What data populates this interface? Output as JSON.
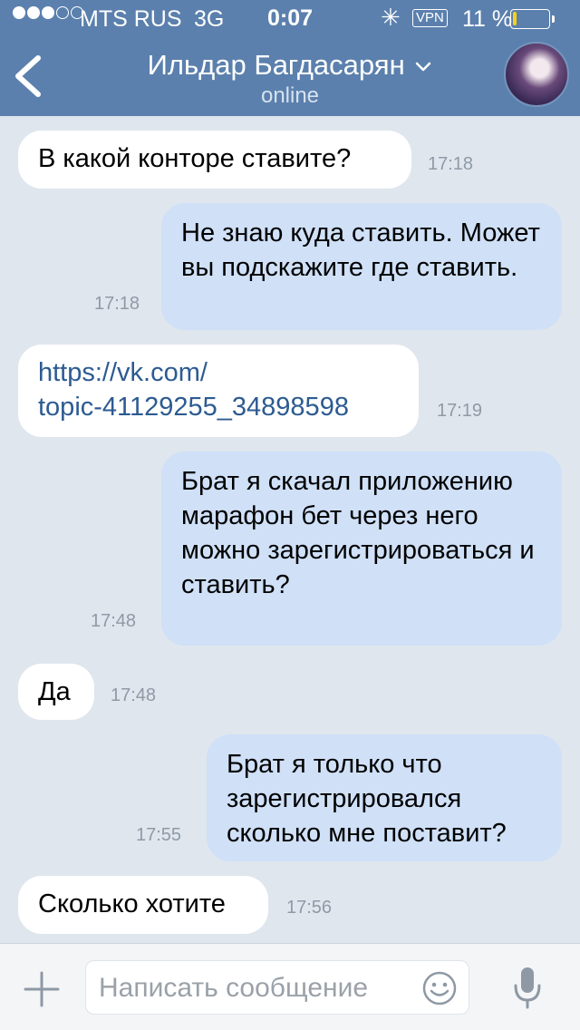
{
  "status_bar": {
    "carrier": "MTS RUS",
    "network": "3G",
    "time": "0:07",
    "vpn": "VPN",
    "battery_percent": "11 %",
    "battery_level": 0.11,
    "battery_color": "#f7d11a"
  },
  "header": {
    "contact_name": "Ильдар Багдасарян",
    "contact_status": "online",
    "back_icon": "chevron-left-icon",
    "name_dropdown_icon": "chevron-down-icon",
    "background": "#5b80ad"
  },
  "messages": [
    {
      "direction": "incoming",
      "text": "В какой конторе ставите?",
      "time": "17:18"
    },
    {
      "direction": "outgoing",
      "text": "Не знаю куда ставить. Может вы подскажите где ставить.",
      "time": "17:18"
    },
    {
      "direction": "incoming",
      "text": "https://vk.com/topic-41129255_34898598",
      "time": "17:19",
      "is_link": true
    },
    {
      "direction": "outgoing",
      "text": "Брат я скачал приложению марафон бет через него можно зарегистрироваться и ставить?",
      "time": "17:48"
    },
    {
      "direction": "incoming",
      "text": "Да",
      "time": "17:48"
    },
    {
      "direction": "outgoing",
      "text": "Брат я только что зарегистрировался сколько мне поставит?",
      "time": "17:55"
    },
    {
      "direction": "incoming",
      "text": "Сколько хотите",
      "time": "17:56"
    }
  ],
  "composer": {
    "placeholder": "Написать сообщение",
    "value": "",
    "attach_icon": "plus-icon",
    "emoji_icon": "smile-icon",
    "voice_icon": "microphone-icon"
  }
}
